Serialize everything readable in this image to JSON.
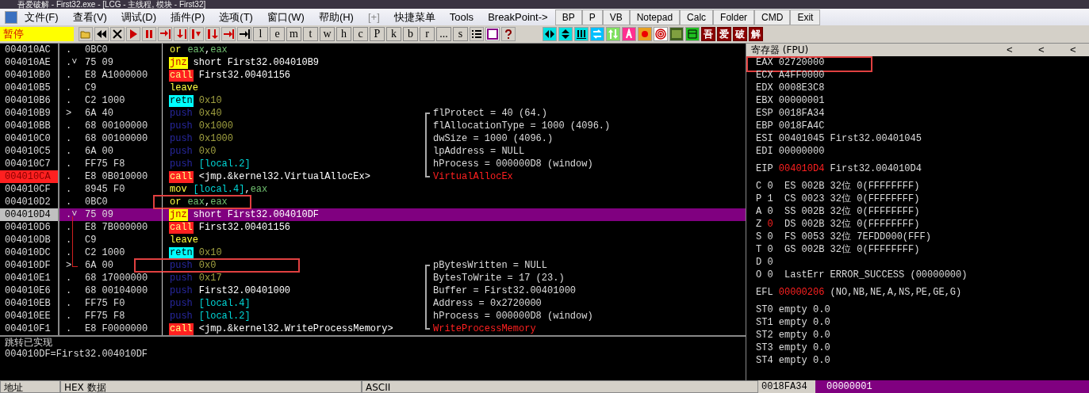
{
  "window": {
    "title": "吾爱破解 - First32.exe - [LCG - 主线程, 模块 - First32]"
  },
  "menu": [
    "文件(F)",
    "查看(V)",
    "调试(D)",
    "插件(P)",
    "选项(T)",
    "窗口(W)",
    "帮助(H)",
    "[+]",
    "快捷菜单",
    "Tools",
    "BreakPoint->"
  ],
  "quick_buttons": [
    "BP",
    "P",
    "VB",
    "Notepad",
    "Calc",
    "Folder",
    "CMD",
    "Exit"
  ],
  "status": "暂停",
  "letter_buttons": [
    "l",
    "e",
    "m",
    "t",
    "w",
    "h",
    "c",
    "P",
    "k",
    "b",
    "r",
    "...",
    "s"
  ],
  "tool_buttons": [
    "吾",
    "爱",
    "破",
    "解"
  ],
  "disassembly": [
    {
      "address": "004010AC",
      "marker": ".",
      "hex": "0BC0",
      "mnemonic": "or",
      "kind": "or",
      "operand": [
        {
          "text": "eax",
          "kind": "reg"
        },
        {
          "text": ",",
          "kind": "sym"
        },
        {
          "text": "eax",
          "kind": "reg"
        }
      ],
      "breakpoint": false,
      "selected": false,
      "boxed": false
    },
    {
      "address": "004010AE",
      "marker": ".˅",
      "hex": "75 09",
      "mnemonic": "jnz",
      "kind": "jump",
      "operand": [
        {
          "text": "short First32.004010B9",
          "kind": "sym"
        }
      ],
      "breakpoint": false,
      "selected": false,
      "boxed": false
    },
    {
      "address": "004010B0",
      "marker": ".",
      "hex": "E8 A1000000",
      "mnemonic": "call",
      "kind": "call",
      "operand": [
        {
          "text": "First32.00401156",
          "kind": "sym"
        }
      ],
      "breakpoint": false,
      "selected": false,
      "boxed": false
    },
    {
      "address": "004010B5",
      "marker": ".",
      "hex": "C9",
      "mnemonic": "leave",
      "kind": "plain",
      "breakpoint": false,
      "selected": false,
      "boxed": false
    },
    {
      "address": "004010B6",
      "marker": ".",
      "hex": "C2 1000",
      "mnemonic": "retn",
      "kind": "ret",
      "operand": [
        {
          "text": "0x10",
          "kind": "imm"
        }
      ],
      "breakpoint": false,
      "selected": false,
      "boxed": false
    },
    {
      "address": "004010B9",
      "marker": ">",
      "hex": "6A 40",
      "mnemonic": "push",
      "kind": "push",
      "operand": [
        {
          "text": "0x40",
          "kind": "imm"
        }
      ],
      "breakpoint": false,
      "selected": false,
      "boxed": false,
      "comment": {
        "text": "flProtect = 40 (64.)",
        "kind": "arg"
      }
    },
    {
      "address": "004010BB",
      "marker": ".",
      "hex": "68 00100000",
      "mnemonic": "push",
      "kind": "push",
      "operand": [
        {
          "text": "0x1000",
          "kind": "imm"
        }
      ],
      "breakpoint": false,
      "selected": false,
      "boxed": false,
      "comment": {
        "text": "flAllocationType = 1000 (4096.)",
        "kind": "arg"
      }
    },
    {
      "address": "004010C0",
      "marker": ".",
      "hex": "68 00100000",
      "mnemonic": "push",
      "kind": "push",
      "operand": [
        {
          "text": "0x1000",
          "kind": "imm"
        }
      ],
      "breakpoint": false,
      "selected": false,
      "boxed": false,
      "comment": {
        "text": "dwSize = 1000 (4096.)",
        "kind": "arg"
      }
    },
    {
      "address": "004010C5",
      "marker": ".",
      "hex": "6A 00",
      "mnemonic": "push",
      "kind": "push",
      "operand": [
        {
          "text": "0x0",
          "kind": "imm"
        }
      ],
      "breakpoint": false,
      "selected": false,
      "boxed": false,
      "comment": {
        "text": "lpAddress = NULL",
        "kind": "arg"
      }
    },
    {
      "address": "004010C7",
      "marker": ".",
      "hex": "FF75 F8",
      "mnemonic": "push",
      "kind": "push",
      "operand": [
        {
          "text": "[local.2]",
          "kind": "mem"
        }
      ],
      "breakpoint": false,
      "selected": false,
      "boxed": false,
      "comment": {
        "text": "hProcess = 000000D8 (window)",
        "kind": "arg"
      }
    },
    {
      "address": "004010CA",
      "marker": ".",
      "hex": "E8 0B010000",
      "mnemonic": "call",
      "kind": "call",
      "operand": [
        {
          "text": "<jmp.&kernel32.VirtualAllocEx>",
          "kind": "sym"
        }
      ],
      "breakpoint": true,
      "selected": false,
      "boxed": false,
      "comment": {
        "text": "VirtualAllocEx",
        "kind": "api"
      }
    },
    {
      "address": "004010CF",
      "marker": ".",
      "hex": "8945 F0",
      "mnemonic": "mov",
      "kind": "plain",
      "operand": [
        {
          "text": "[local.4]",
          "kind": "mem"
        },
        {
          "text": ",",
          "kind": "sym"
        },
        {
          "text": "eax",
          "kind": "reg"
        }
      ],
      "breakpoint": false,
      "selected": false,
      "boxed": false
    },
    {
      "address": "004010D2",
      "marker": ".",
      "hex": "0BC0",
      "mnemonic": "or",
      "kind": "or",
      "operand": [
        {
          "text": "eax",
          "kind": "reg"
        },
        {
          "text": ",",
          "kind": "sym"
        },
        {
          "text": "eax",
          "kind": "reg"
        }
      ],
      "breakpoint": false,
      "selected": false,
      "boxed": true
    },
    {
      "address": "004010D4",
      "marker": ".˅",
      "hex": "75 09",
      "mnemonic": "jnz",
      "kind": "jump",
      "operand": [
        {
          "text": "short First32.004010DF",
          "kind": "sym"
        }
      ],
      "breakpoint": false,
      "selected": true,
      "boxed": false,
      "jump_line": true
    },
    {
      "address": "004010D6",
      "marker": ".",
      "hex": "E8 7B000000",
      "mnemonic": "call",
      "kind": "call",
      "operand": [
        {
          "text": "First32.00401156",
          "kind": "sym"
        }
      ],
      "breakpoint": false,
      "selected": false,
      "boxed": false,
      "jump_line": true
    },
    {
      "address": "004010DB",
      "marker": ".",
      "hex": "C9",
      "mnemonic": "leave",
      "kind": "plain",
      "breakpoint": false,
      "selected": false,
      "boxed": false,
      "jump_line": true
    },
    {
      "address": "004010DC",
      "marker": ".",
      "hex": "C2 1000",
      "mnemonic": "retn",
      "kind": "ret",
      "operand": [
        {
          "text": "0x10",
          "kind": "imm"
        }
      ],
      "breakpoint": false,
      "selected": false,
      "boxed": false,
      "jump_line": true
    },
    {
      "address": "004010DF",
      "marker": ">",
      "hex": "6A 00",
      "mnemonic": "push",
      "kind": "push",
      "operand": [
        {
          "text": "0x0",
          "kind": "imm"
        }
      ],
      "breakpoint": false,
      "selected": false,
      "boxed": true,
      "jump_line": true,
      "comment": {
        "text": "pBytesWritten = NULL",
        "kind": "arg"
      }
    },
    {
      "address": "004010E1",
      "marker": ".",
      "hex": "68 17000000",
      "mnemonic": "push",
      "kind": "push",
      "operand": [
        {
          "text": "0x17",
          "kind": "imm"
        }
      ],
      "breakpoint": false,
      "selected": false,
      "boxed": false,
      "comment": {
        "text": "BytesToWrite = 17 (23.)",
        "kind": "arg"
      }
    },
    {
      "address": "004010E6",
      "marker": ".",
      "hex": "68 00104000",
      "mnemonic": "push",
      "kind": "push",
      "operand": [
        {
          "text": "First32.00401000",
          "kind": "sym"
        }
      ],
      "breakpoint": false,
      "selected": false,
      "boxed": false,
      "comment": {
        "text": "Buffer = First32.00401000",
        "kind": "arg"
      }
    },
    {
      "address": "004010EB",
      "marker": ".",
      "hex": "FF75 F0",
      "mnemonic": "push",
      "kind": "push",
      "operand": [
        {
          "text": "[local.4]",
          "kind": "mem"
        }
      ],
      "breakpoint": false,
      "selected": false,
      "boxed": false,
      "comment": {
        "text": "Address = 0x2720000",
        "kind": "arg"
      }
    },
    {
      "address": "004010EE",
      "marker": ".",
      "hex": "FF75 F8",
      "mnemonic": "push",
      "kind": "push",
      "operand": [
        {
          "text": "[local.2]",
          "kind": "mem"
        }
      ],
      "breakpoint": false,
      "selected": false,
      "boxed": false,
      "comment": {
        "text": "hProcess = 000000D8 (window)",
        "kind": "arg"
      }
    },
    {
      "address": "004010F1",
      "marker": ".",
      "hex": "E8 F0000000",
      "mnemonic": "call",
      "kind": "call",
      "operand": [
        {
          "text": "<jmp.&kernel32.WriteProcessMemory>",
          "kind": "sym"
        }
      ],
      "breakpoint": false,
      "selected": false,
      "boxed": false,
      "comment": {
        "text": "WriteProcessMemory",
        "kind": "api"
      }
    }
  ],
  "info": [
    "跳转已实现",
    "004010DF=First32.004010DF"
  ],
  "registers": {
    "title": "寄存器 (FPU)",
    "nav": [
      "<",
      "<",
      "<"
    ],
    "general": [
      {
        "name": "EAX",
        "value": "02720000",
        "boxed": true
      },
      {
        "name": "ECX",
        "value": "A4FF0000",
        "boxed": false
      },
      {
        "name": "EDX",
        "value": "0008E3C8",
        "boxed": false
      },
      {
        "name": "EBX",
        "value": "00000001",
        "boxed": false
      },
      {
        "name": "ESP",
        "value": "0018FA34",
        "boxed": false
      },
      {
        "name": "EBP",
        "value": "0018FA4C",
        "boxed": false
      },
      {
        "name": "ESI",
        "value": "00401045",
        "extra": "First32.00401045",
        "boxed": false
      },
      {
        "name": "EDI",
        "value": "00000000",
        "boxed": false
      }
    ],
    "eip": {
      "name": "EIP",
      "value": "004010D4",
      "extra": "First32.004010D4",
      "changed": true
    },
    "flags": [
      {
        "flag": "C",
        "value": "0",
        "changed": false,
        "seg": "ES",
        "selector": "002B",
        "bits": "32位",
        "base": "0(FFFFFFFF)"
      },
      {
        "flag": "P",
        "value": "1",
        "changed": false,
        "seg": "CS",
        "selector": "0023",
        "bits": "32位",
        "base": "0(FFFFFFFF)"
      },
      {
        "flag": "A",
        "value": "0",
        "changed": false,
        "seg": "SS",
        "selector": "002B",
        "bits": "32位",
        "base": "0(FFFFFFFF)"
      },
      {
        "flag": "Z",
        "value": "0",
        "changed": true,
        "seg": "DS",
        "selector": "002B",
        "bits": "32位",
        "base": "0(FFFFFFFF)"
      },
      {
        "flag": "S",
        "value": "0",
        "changed": false,
        "seg": "FS",
        "selector": "0053",
        "bits": "32位",
        "base": "7EFDD000(FFF)"
      },
      {
        "flag": "T",
        "value": "0",
        "changed": false,
        "seg": "GS",
        "selector": "002B",
        "bits": "32位",
        "base": "0(FFFFFFFF)"
      },
      {
        "flag": "D",
        "value": "0",
        "changed": false
      },
      {
        "flag": "O",
        "value": "0",
        "changed": false,
        "seg": "LastErr",
        "selector": "ERROR_SUCCESS (00000000)"
      }
    ],
    "efl": {
      "name": "EFL",
      "value": "00000206",
      "extra": "(NO,NB,NE,A,NS,PE,GE,G)",
      "changed": true
    },
    "fpu": [
      {
        "name": "ST0",
        "value": "empty 0.0"
      },
      {
        "name": "ST1",
        "value": "empty 0.0"
      },
      {
        "name": "ST2",
        "value": "empty 0.0"
      },
      {
        "name": "ST3",
        "value": "empty 0.0"
      },
      {
        "name": "ST4",
        "value": "empty 0.0"
      }
    ]
  },
  "bottom": {
    "dump_columns": [
      "地址",
      "HEX 数据",
      "ASCII"
    ],
    "stack": [
      {
        "address": "0018FA34",
        "value": "00000001",
        "selected": true
      }
    ]
  }
}
